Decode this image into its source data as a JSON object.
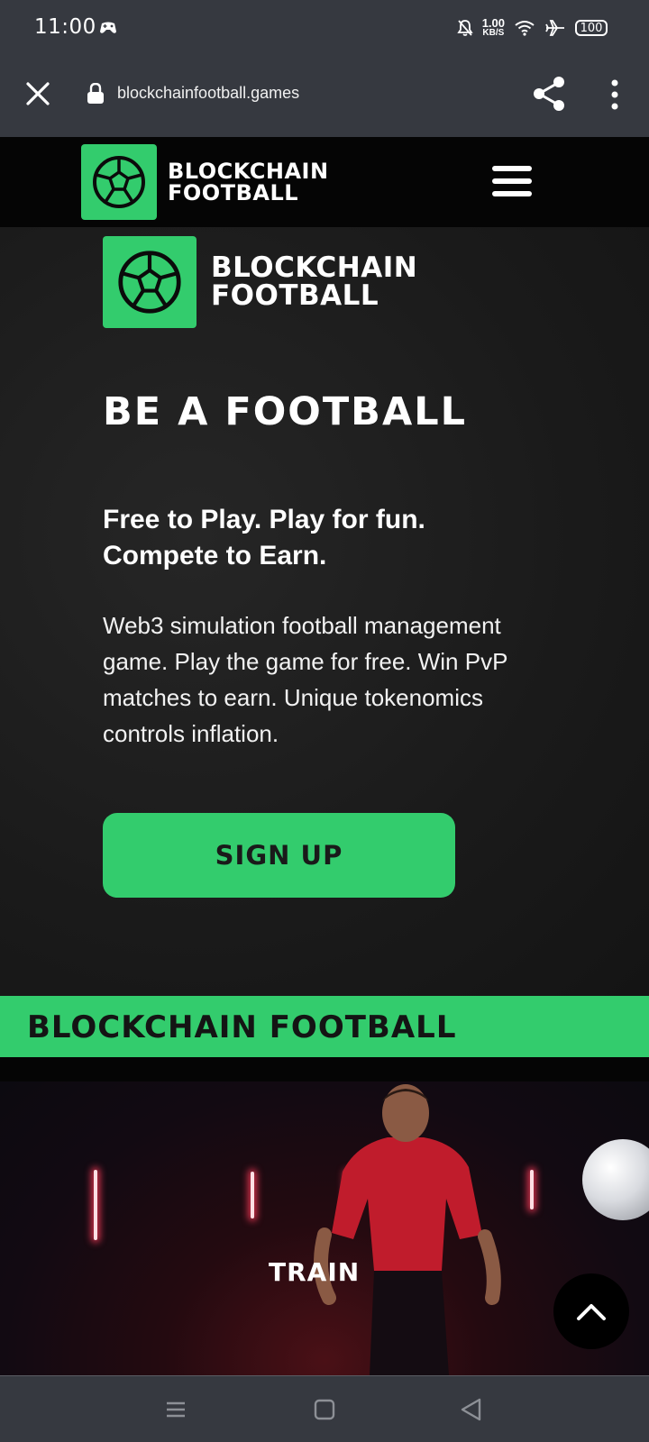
{
  "status_bar": {
    "time": "11:00",
    "net_speed_value": "1.00",
    "net_speed_unit": "KB/S",
    "battery": "100"
  },
  "browser": {
    "url": "blockchainfootball.games"
  },
  "site_header": {
    "logo_line1": "BLOCKCHAIN",
    "logo_line2": "FOOTBALL"
  },
  "hero": {
    "logo_line1": "BLOCKCHAIN",
    "logo_line2": "FOOTBALL",
    "heading": "BE A FOOTBALL",
    "tagline_line1": "Free to Play. Play for fun.",
    "tagline_line2": "Compete to Earn.",
    "description": "Web3 simulation football management game. Play the game for free. Win PvP matches to earn. Unique tokenomics controls inflation.",
    "signup_label": "SIGN UP"
  },
  "marquee": {
    "text": "BLOCKCHAIN FOOTBALL"
  },
  "video": {
    "label": "TRAIN"
  },
  "colors": {
    "brand_green": "#33cc6d",
    "chrome_gray": "#363940",
    "background_dark": "#1b1b1b"
  }
}
